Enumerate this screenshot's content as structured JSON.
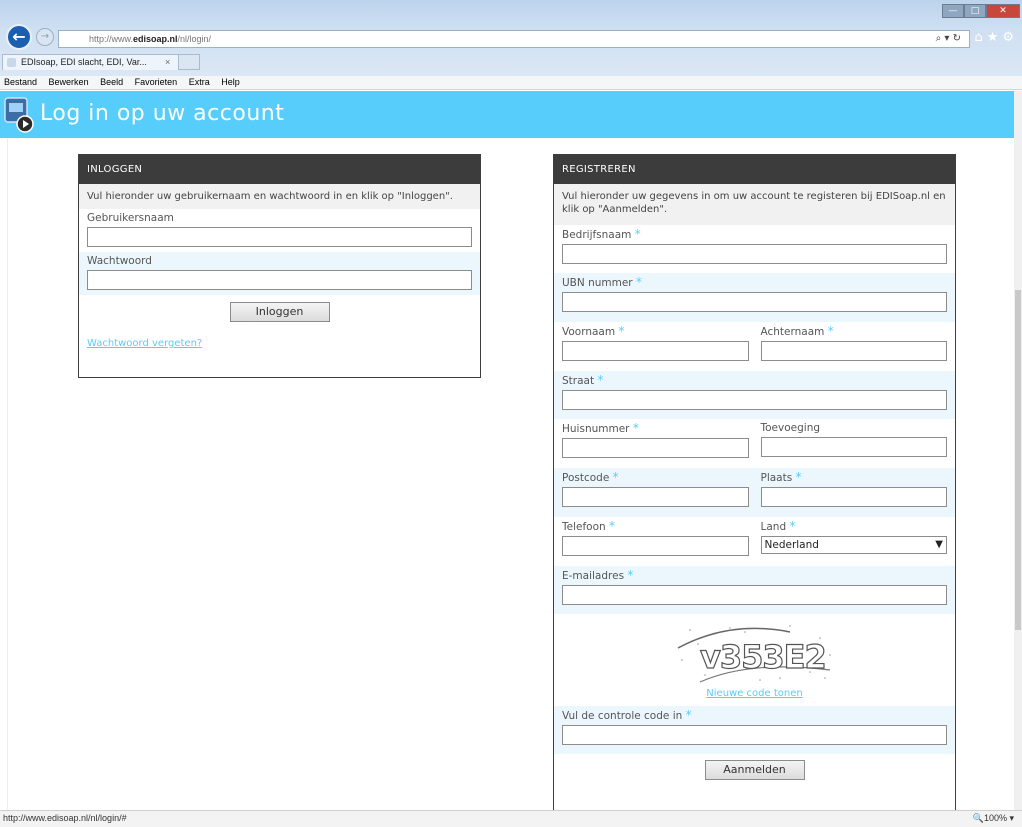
{
  "browser": {
    "url_prefix": "http://www.",
    "url_domain": "edisoap.nl",
    "url_path": "/nl/login/",
    "tab_title": "EDIsoap, EDI slacht, EDI, Var...",
    "tab_close": "×",
    "addr_icons": "⌕ ▾ ↻",
    "right_icons": "⌂★⚙",
    "menu": [
      "Bestand",
      "Bewerken",
      "Beeld",
      "Favorieten",
      "Extra",
      "Help"
    ],
    "status_url": "http://www.edisoap.nl/nl/login/#",
    "zoom": "🔍100%  ▾"
  },
  "page": {
    "title": "Log in op uw account"
  },
  "login": {
    "heading": "INLOGGEN",
    "intro": "Vul hieronder uw gebruikernaam en wachtwoord in en klik op \"Inloggen\".",
    "username_label": "Gebruikersnaam",
    "password_label": "Wachtwoord",
    "submit": "Inloggen",
    "forgot": "Wachtwoord vergeten?"
  },
  "register": {
    "heading": "REGISTREREN",
    "intro": "Vul hieronder uw gegevens in om uw account te registeren bij EDISoap.nl en klik op \"Aanmelden\".",
    "company": "Bedrijfsnaam",
    "ubn": "UBN nummer",
    "firstname": "Voornaam",
    "lastname": "Achternaam",
    "street": "Straat",
    "housenumber": "Huisnummer",
    "addition": "Toevoeging",
    "postcode": "Postcode",
    "city": "Plaats",
    "phone": "Telefoon",
    "country": "Land",
    "country_value": "Nederland",
    "email": "E-mailadres",
    "captcha_text": "v353E2",
    "new_code": "Nieuwe code tonen",
    "control_code": "Vul de controle code in",
    "submit": "Aanmelden",
    "required_mark": "*"
  },
  "colors": {
    "accent": "#57cdfb",
    "panel_header": "#3c3c3c"
  }
}
